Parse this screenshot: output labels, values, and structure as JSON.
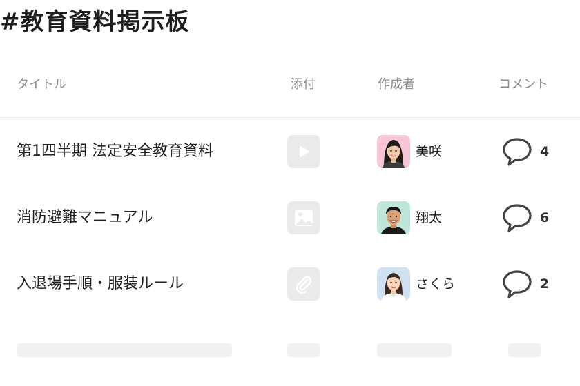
{
  "page": {
    "title": "#教育資料掲示板"
  },
  "table": {
    "headers": {
      "title": "タイトル",
      "attachment": "添付",
      "author": "作成者",
      "comments": "コメント"
    },
    "rows": [
      {
        "title": "第1四半期 法定安全教育資料",
        "attachment_icon": "video-play-icon",
        "author": "美咲",
        "comment_count": "4"
      },
      {
        "title": "消防避難マニュアル",
        "attachment_icon": "image-icon",
        "author": "翔太",
        "comment_count": "6"
      },
      {
        "title": "入退場手順・服装ルール",
        "attachment_icon": "paperclip-icon",
        "author": "さくら",
        "comment_count": "2"
      }
    ]
  },
  "colors": {
    "header_text": "#8c8c8c",
    "attachment_bg": "#ebebeb",
    "skeleton": "#f1f1f1",
    "comment_icon": "#444444"
  }
}
